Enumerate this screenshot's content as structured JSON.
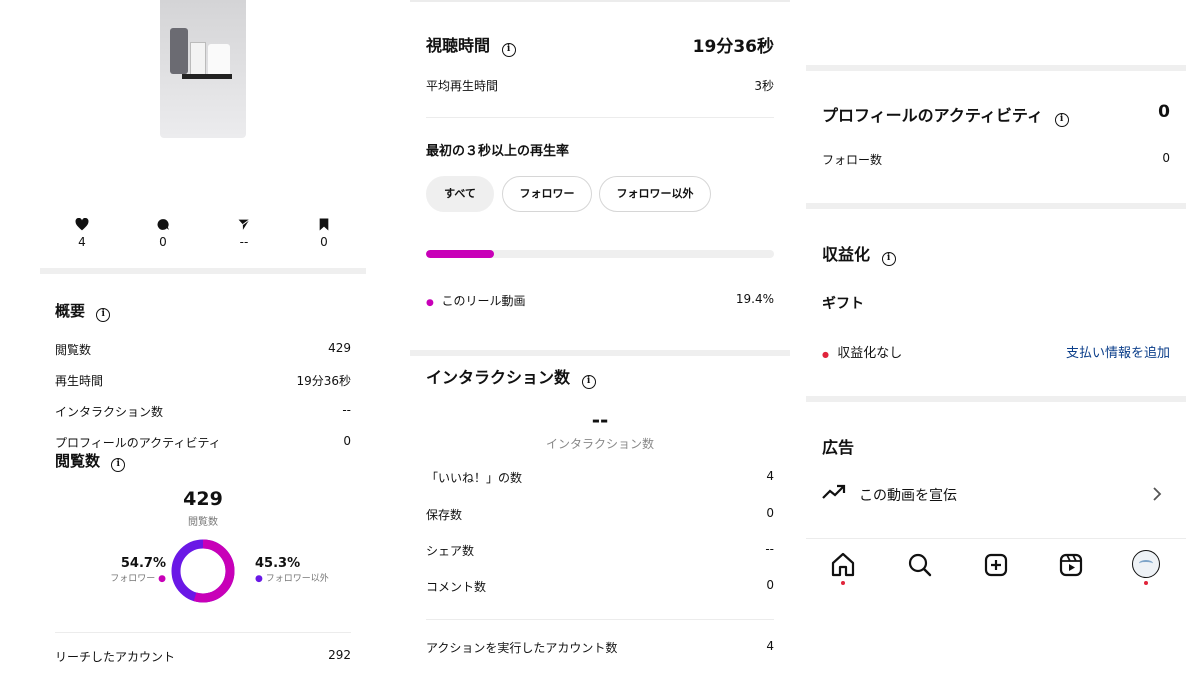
{
  "left": {
    "stats": [
      {
        "icon": "heart-icon",
        "value": "4"
      },
      {
        "icon": "comment-icon",
        "value": "0"
      },
      {
        "icon": "share-icon",
        "value": "--"
      },
      {
        "icon": "bookmark-icon",
        "value": "0"
      }
    ],
    "overview": {
      "title": "概要",
      "rows": [
        {
          "label": "閲覧数",
          "value": "429"
        },
        {
          "label": "再生時間",
          "value": "19分36秒"
        },
        {
          "label": "インタラクション数",
          "value": "--"
        },
        {
          "label": "プロフィールのアクティビティ",
          "value": "0"
        }
      ]
    },
    "views": {
      "title": "閲覧数",
      "total": "429",
      "total_label": "閲覧数",
      "follower_pct": "54.7%",
      "follower_label": "フォロワー",
      "nonfollower_pct": "45.3%",
      "nonfollower_label": "フォロワー以外",
      "follower_fraction": 0.547
    },
    "reach": {
      "label": "リーチしたアカウント",
      "value": "292"
    }
  },
  "middle": {
    "watch_time": {
      "title": "視聴時間",
      "value": "19分36秒"
    },
    "avg_watch": {
      "label": "平均再生時間",
      "value": "3秒"
    },
    "retention": {
      "title": "最初の３秒以上の再生率",
      "tabs": [
        "すべて",
        "フォロワー",
        "フォロワー以外"
      ],
      "selected_tab": "すべて",
      "bar_fraction": 0.194,
      "legend_label": "このリール動画",
      "legend_value": "19.4%"
    },
    "interactions": {
      "title": "インタラクション数",
      "big_value": "--",
      "big_label": "インタラクション数",
      "rows": [
        {
          "label": "「いいね！」の数",
          "value": "4"
        },
        {
          "label": "保存数",
          "value": "0"
        },
        {
          "label": "シェア数",
          "value": "--"
        },
        {
          "label": "コメント数",
          "value": "0"
        }
      ],
      "accounts": {
        "label": "アクションを実行したアカウント数",
        "value": "4"
      }
    }
  },
  "right": {
    "profile": {
      "title": "プロフィールのアクティビティ",
      "value": "0",
      "row_label": "フォロー数",
      "row_value": "0"
    },
    "monetization": {
      "title": "収益化",
      "gift": "ギフト",
      "status": "収益化なし",
      "link": "支払い情報を追加"
    },
    "ads": {
      "title": "広告",
      "promote": "この動画を宣伝"
    },
    "nav": [
      "home-icon",
      "search-icon",
      "create-icon",
      "reels-icon",
      "profile-avatar"
    ]
  },
  "colors": {
    "accent": "#c800b8",
    "secondary": "#6a18e6",
    "link": "#0b3e8a",
    "dot_red": "#e0243b"
  }
}
